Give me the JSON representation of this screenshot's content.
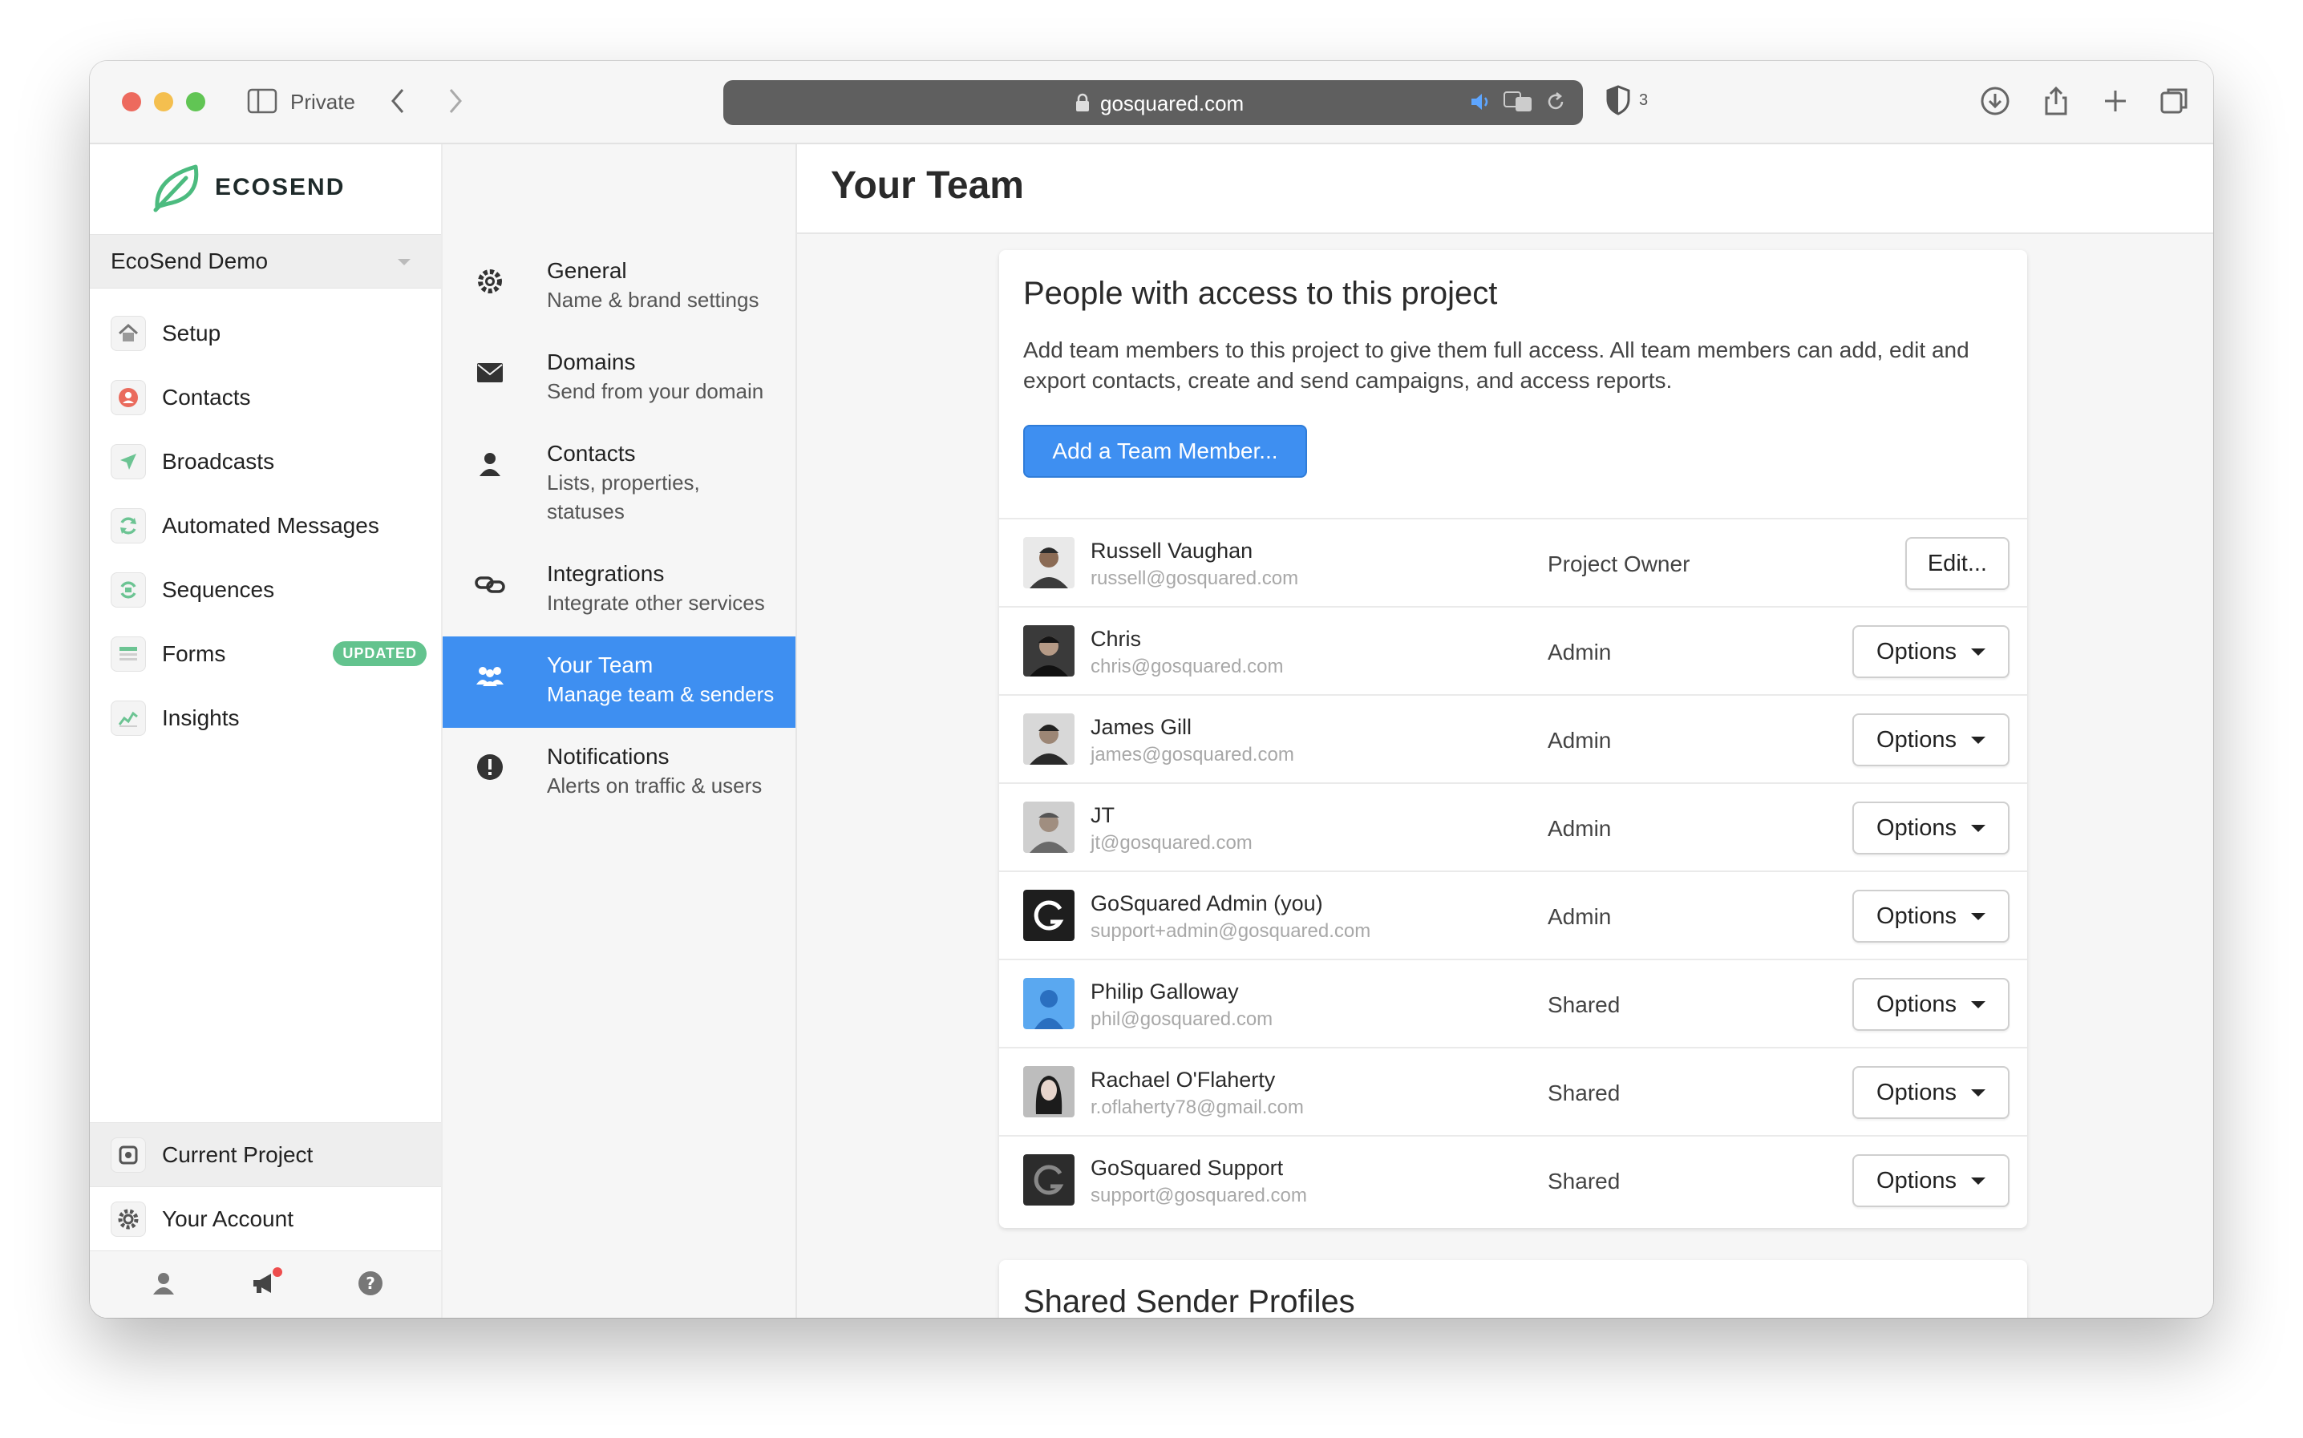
{
  "browser": {
    "private_label": "Private",
    "url": "gosquared.com",
    "shield_count": "3"
  },
  "app": {
    "logo_text": "ECOSEND",
    "project_name": "EcoSend Demo",
    "nav": [
      {
        "label": "Setup",
        "icon": "home-icon"
      },
      {
        "label": "Contacts",
        "icon": "contacts-icon"
      },
      {
        "label": "Broadcasts",
        "icon": "send-icon"
      },
      {
        "label": "Automated Messages",
        "icon": "refresh-icon"
      },
      {
        "label": "Sequences",
        "icon": "sequence-icon"
      },
      {
        "label": "Forms",
        "icon": "form-icon",
        "badge": "UPDATED"
      },
      {
        "label": "Insights",
        "icon": "chart-icon"
      }
    ],
    "bottom_nav": [
      {
        "label": "Current Project",
        "icon": "project-icon"
      },
      {
        "label": "Your Account",
        "icon": "gear-icon"
      }
    ]
  },
  "settings": [
    {
      "title": "General",
      "subtitle": "Name & brand settings",
      "icon": "gear-icon"
    },
    {
      "title": "Domains",
      "subtitle": "Send from your domain",
      "icon": "envelope-icon"
    },
    {
      "title": "Contacts",
      "subtitle": "Lists, properties, statuses",
      "icon": "person-icon"
    },
    {
      "title": "Integrations",
      "subtitle": "Integrate other services",
      "icon": "link-icon"
    },
    {
      "title": "Your Team",
      "subtitle": "Manage team & senders",
      "icon": "team-icon"
    },
    {
      "title": "Notifications",
      "subtitle": "Alerts on traffic & users",
      "icon": "alert-icon"
    }
  ],
  "main": {
    "title": "Your Team",
    "card": {
      "title": "People with access to this project",
      "description": "Add team members to this project to give them full access. All team members can add, edit and export contacts, create and send campaigns, and access reports.",
      "add_button": "Add a Team Member..."
    },
    "members": [
      {
        "name": "Russell Vaughan",
        "email": "russell@gosquared.com",
        "role": "Project Owner",
        "action": "Edit..."
      },
      {
        "name": "Chris",
        "email": "chris@gosquared.com",
        "role": "Admin",
        "action": "Options"
      },
      {
        "name": "James Gill",
        "email": "james@gosquared.com",
        "role": "Admin",
        "action": "Options"
      },
      {
        "name": "JT",
        "email": "jt@gosquared.com",
        "role": "Admin",
        "action": "Options"
      },
      {
        "name": "GoSquared Admin (you)",
        "email": "support+admin@gosquared.com",
        "role": "Admin",
        "action": "Options"
      },
      {
        "name": "Philip Galloway",
        "email": "phil@gosquared.com",
        "role": "Shared",
        "action": "Options"
      },
      {
        "name": "Rachael O'Flaherty",
        "email": "r.oflaherty78@gmail.com",
        "role": "Shared",
        "action": "Options"
      },
      {
        "name": "GoSquared Support",
        "email": "support@gosquared.com",
        "role": "Shared",
        "action": "Options"
      }
    ],
    "second_card_title": "Shared Sender Profiles"
  },
  "colors": {
    "accent": "#3e8ff1",
    "badge": "#63c38e",
    "logo_green": "#4cbb7f"
  }
}
